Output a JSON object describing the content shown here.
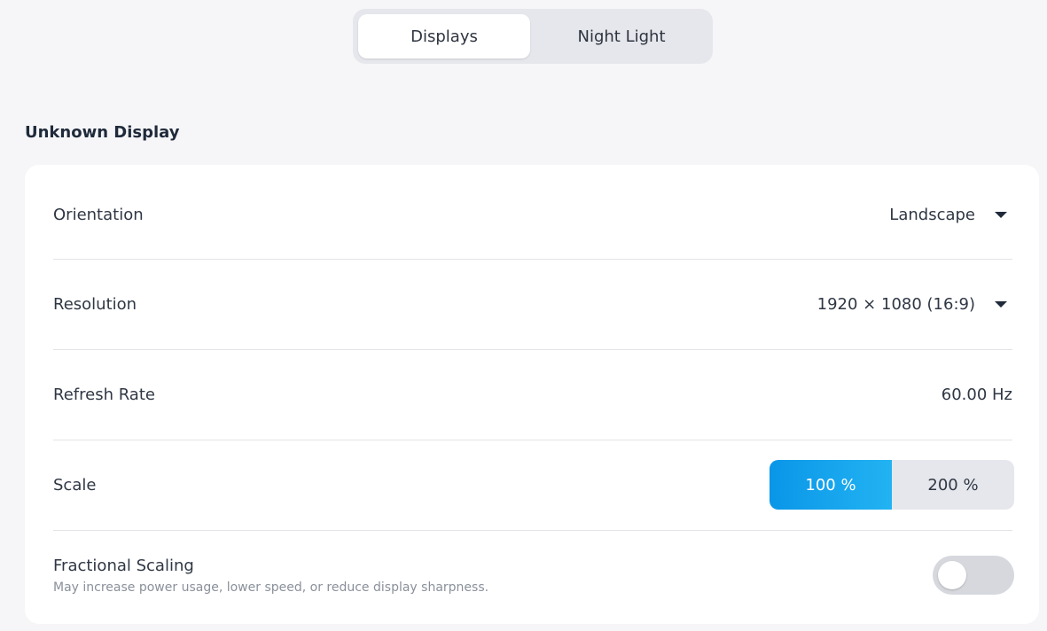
{
  "tabs": [
    {
      "label": "Displays",
      "active": true
    },
    {
      "label": "Night Light",
      "active": false
    }
  ],
  "section": {
    "title": "Unknown Display"
  },
  "settings": {
    "orientation": {
      "label": "Orientation",
      "value": "Landscape"
    },
    "resolution": {
      "label": "Resolution",
      "value": "1920 × 1080 (16:9)"
    },
    "refresh_rate": {
      "label": "Refresh Rate",
      "value": "60.00 Hz"
    },
    "scale": {
      "label": "Scale",
      "options": [
        {
          "label": "100 %",
          "selected": true
        },
        {
          "label": "200 %",
          "selected": false
        }
      ]
    },
    "fractional_scaling": {
      "label": "Fractional Scaling",
      "description": "May increase power usage, lower speed, or reduce display sharpness.",
      "enabled": false
    }
  },
  "colors": {
    "accent": "#0a96e8",
    "background": "#f6f6f8",
    "card": "#ffffff",
    "toggle_off": "#d6d8de"
  }
}
